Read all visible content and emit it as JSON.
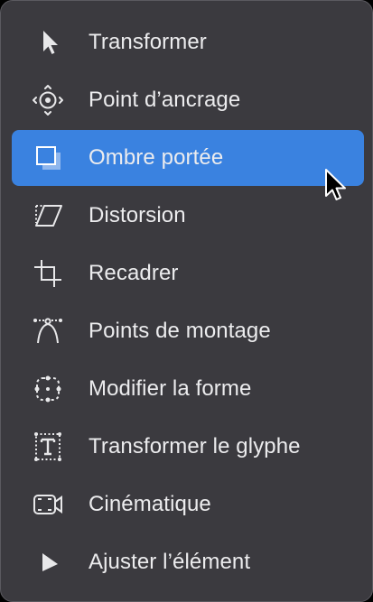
{
  "menu": {
    "items": [
      {
        "label": "Transformer",
        "icon": "select-arrow-icon",
        "selected": false
      },
      {
        "label": "Point d’ancrage",
        "icon": "anchor-point-icon",
        "selected": false
      },
      {
        "label": "Ombre portée",
        "icon": "drop-shadow-icon",
        "selected": true
      },
      {
        "label": "Distorsion",
        "icon": "distort-icon",
        "selected": false
      },
      {
        "label": "Recadrer",
        "icon": "crop-icon",
        "selected": false
      },
      {
        "label": "Points de montage",
        "icon": "edit-points-icon",
        "selected": false
      },
      {
        "label": "Modifier la forme",
        "icon": "edit-shape-icon",
        "selected": false
      },
      {
        "label": "Transformer le glyphe",
        "icon": "transform-glyph-icon",
        "selected": false
      },
      {
        "label": "Cinématique",
        "icon": "kinematic-camera-icon",
        "selected": false
      },
      {
        "label": "Ajuster l’élément",
        "icon": "adjust-item-icon",
        "selected": false
      }
    ]
  },
  "colors": {
    "menu_background": "#3b3a3f",
    "selected_background": "#3a82e0",
    "text": "#ececee",
    "icon": "#e8e8ea"
  },
  "cursor": {
    "icon": "mouse-pointer-icon"
  }
}
